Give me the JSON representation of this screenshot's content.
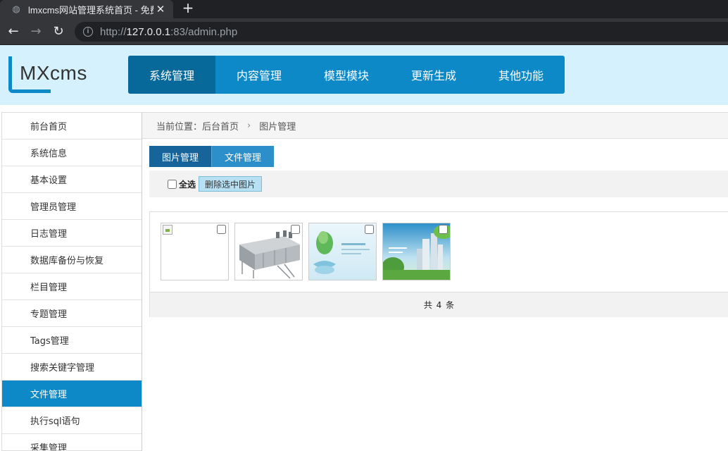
{
  "browser": {
    "tab_title": "lmxcms网站管理系统首页 - 免费",
    "url_scheme": "http://",
    "url_host": "127.0.0.1",
    "url_rest": ":83/admin.php"
  },
  "header": {
    "logo_text": "MXcms",
    "nav": [
      {
        "label": "系统管理",
        "active": true
      },
      {
        "label": "内容管理"
      },
      {
        "label": "模型模块"
      },
      {
        "label": "更新生成"
      },
      {
        "label": "其他功能"
      }
    ]
  },
  "sidebar": {
    "items": [
      {
        "label": "前台首页"
      },
      {
        "label": "系统信息"
      },
      {
        "label": "基本设置"
      },
      {
        "label": "管理员管理"
      },
      {
        "label": "日志管理"
      },
      {
        "label": "数据库备份与恢复"
      },
      {
        "label": "栏目管理"
      },
      {
        "label": "专题管理"
      },
      {
        "label": "Tags管理"
      },
      {
        "label": "搜索关键字管理"
      },
      {
        "label": "文件管理",
        "active": true
      },
      {
        "label": "执行sql语句"
      },
      {
        "label": "采集管理"
      }
    ]
  },
  "breadcrumb": {
    "prefix": "当前位置：",
    "home": "后台首页",
    "separator": "›",
    "current": "图片管理"
  },
  "subtabs": [
    {
      "label": "图片管理",
      "active": true
    },
    {
      "label": "文件管理"
    }
  ],
  "toolbar": {
    "select_all": "全选",
    "delete_selected": "删除选中图片"
  },
  "gallery": {
    "images": [
      {
        "kind": "broken"
      },
      {
        "kind": "machine"
      },
      {
        "kind": "water-hands"
      },
      {
        "kind": "buildings"
      }
    ],
    "pager_text": "共 4 条"
  },
  "colors": {
    "accent": "#0e89c7",
    "accent_dark": "#07689a",
    "header_bg": "#d4f1fd"
  }
}
